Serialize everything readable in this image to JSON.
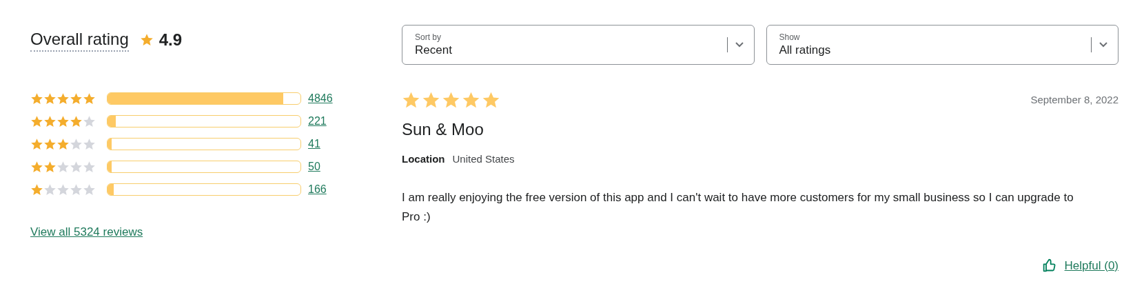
{
  "summary": {
    "title": "Overall rating",
    "score": "4.9",
    "view_all": "View all 5324 reviews"
  },
  "histogram": [
    {
      "stars": 5,
      "level": 0.91,
      "count": "4846"
    },
    {
      "stars": 4,
      "level": 0.042,
      "count": "221"
    },
    {
      "stars": 3,
      "level": 0.008,
      "count": "41"
    },
    {
      "stars": 2,
      "level": 0.009,
      "count": "50"
    },
    {
      "stars": 1,
      "level": 0.031,
      "count": "166"
    }
  ],
  "filters": [
    {
      "label": "Sort by",
      "value": "Recent"
    },
    {
      "label": "Show",
      "value": "All ratings"
    }
  ],
  "review": {
    "stars": 5,
    "date": "September 8, 2022",
    "author": "Sun & Moo",
    "location_label": "Location",
    "location": "United States",
    "body": "I am really enjoying the free version of this app and I can't wait to have more customers for my small business so I can upgrade to Pro :)",
    "helpful": "Helpful (0)"
  }
}
